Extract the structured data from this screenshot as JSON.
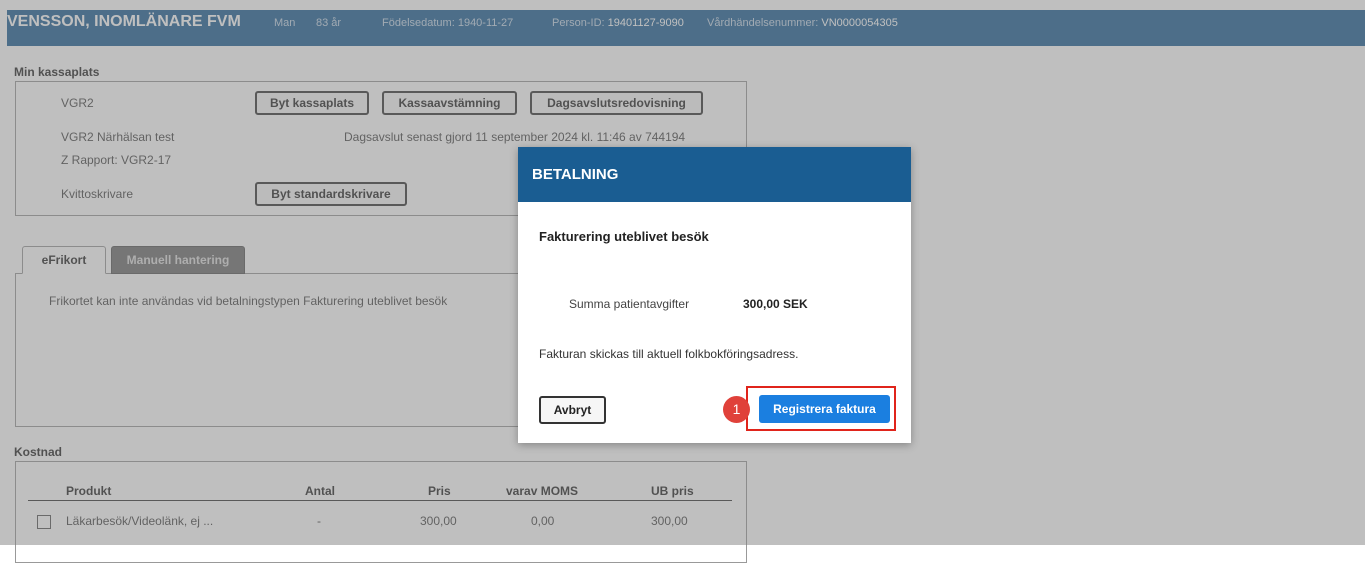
{
  "patient": {
    "name": "VENSSON, INOMLÄNARE FVM",
    "sex": "Man",
    "age": "83 år",
    "birthdate_label": "Födelsedatum:",
    "birthdate": "1940-11-27",
    "person_id_label": "Person-ID:",
    "person_id": "19401127-9090",
    "event_label": "Vårdhändelsenummer:",
    "event_number": "VN0000054305"
  },
  "cash_register": {
    "title": "Min kassaplats",
    "name": "VGR2",
    "unit": "VGR2 Närhälsan test",
    "z_report": "Z Rapport: VGR2-17",
    "printer_label": "Kvittoskrivare",
    "change_register_button": "Byt kassaplats",
    "reconciliation_button": "Kassaavstämning",
    "daily_report_button": "Dagsavslutsredovisning",
    "last_closing_text": "Dagsavslut senast gjord 11 september 2024 kl. 11:46 av 744194",
    "change_printer_button": "Byt standardskrivare"
  },
  "tabs": [
    {
      "label": "eFrikort",
      "active": true
    },
    {
      "label": "Manuell hantering",
      "active": false
    }
  ],
  "tab_content": {
    "message": "Frikortet kan inte användas vid betalningstypen Fakturering uteblivet besök"
  },
  "cost": {
    "title": "Kostnad",
    "headers": [
      "Produkt",
      "Antal",
      "Pris",
      "varav MOMS",
      "UB pris"
    ],
    "rows": [
      {
        "product": "Läkarbesök/Videolänk, ej ...",
        "quantity": "-",
        "price": "300,00",
        "vat": "0,00",
        "ub_price": "300,00"
      }
    ]
  },
  "modal": {
    "title": "BETALNING",
    "subtitle": "Fakturering uteblivet besök",
    "sum_label": "Summa patientavgifter",
    "sum_value": "300,00 SEK",
    "info_text": "Fakturan skickas till aktuell folkbokföringsadress.",
    "cancel_button": "Avbryt",
    "register_button": "Registrera faktura"
  },
  "annotation": {
    "step_number": "1",
    "highlight_color": "#e0241b"
  },
  "colors": {
    "header_bg": "#1a5d92",
    "primary_button": "#1b7fe0"
  }
}
